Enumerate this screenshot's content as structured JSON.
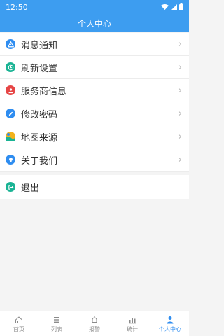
{
  "status_bar": {
    "time": "12:50"
  },
  "header": {
    "title": "个人中心"
  },
  "menu": {
    "items": [
      {
        "label": "消息通知",
        "icon": "warning-icon",
        "color": "#2f8df0"
      },
      {
        "label": "刷新设置",
        "icon": "refresh-clock-icon",
        "color": "#1ab394"
      },
      {
        "label": "服务商信息",
        "icon": "user-card-icon",
        "color": "#e64545"
      },
      {
        "label": "修改密码",
        "icon": "pencil-icon",
        "color": "#2f8df0"
      },
      {
        "label": "地图来源",
        "icon": "map-icon",
        "color": "#f2b21b"
      },
      {
        "label": "关于我们",
        "icon": "lightbulb-icon",
        "color": "#2f8df0"
      }
    ]
  },
  "logout": {
    "label": "退出",
    "icon": "logout-icon",
    "color": "#1ab394"
  },
  "tabs": [
    {
      "label": "首页",
      "icon": "home-icon",
      "active": false
    },
    {
      "label": "列表",
      "icon": "list-icon",
      "active": false
    },
    {
      "label": "报警",
      "icon": "alarm-icon",
      "active": false
    },
    {
      "label": "统计",
      "icon": "bar-chart-icon",
      "active": false
    },
    {
      "label": "个人中心",
      "icon": "person-icon",
      "active": true
    }
  ],
  "colors": {
    "primary": "#3d9df0",
    "active_tab": "#2f8df0"
  }
}
